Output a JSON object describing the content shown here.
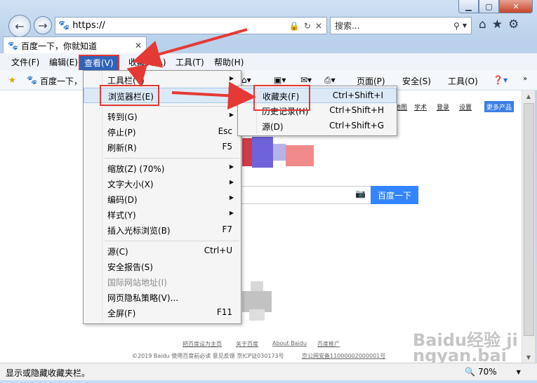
{
  "address": {
    "url": "https://"
  },
  "search": {
    "placeholder": "搜索..."
  },
  "tab": {
    "title": "百度一下，你就知道"
  },
  "menubar": {
    "file": "文件(F)",
    "edit": "编辑(E)",
    "view": "查看(V)",
    "favorites": "收藏夹(A)",
    "tools": "工具(T)",
    "help": "帮助(H)"
  },
  "cmdbar": {
    "favorite_item": "百度一下，...",
    "page": "页面(P)",
    "safety": "安全(S)",
    "tools": "工具(O)"
  },
  "view_menu": {
    "items": [
      {
        "label": "工具栏(T)",
        "shortcut": ""
      },
      {
        "label": "浏览器栏(E)",
        "shortcut": ""
      },
      {
        "label": "转到(G)",
        "shortcut": ""
      },
      {
        "label": "停止(P)",
        "shortcut": "Esc"
      },
      {
        "label": "刷新(R)",
        "shortcut": "F5"
      },
      {
        "label": "缩放(Z) (70%)",
        "shortcut": ""
      },
      {
        "label": "文字大小(X)",
        "shortcut": ""
      },
      {
        "label": "编码(D)",
        "shortcut": ""
      },
      {
        "label": "样式(Y)",
        "shortcut": ""
      },
      {
        "label": "插入光标浏览(B)",
        "shortcut": "F7"
      },
      {
        "label": "源(C)",
        "shortcut": "Ctrl+U"
      },
      {
        "label": "安全报告(S)",
        "shortcut": ""
      },
      {
        "label": "国际网站地址(I)",
        "shortcut": ""
      },
      {
        "label": "网页隐私策略(V)...",
        "shortcut": ""
      },
      {
        "label": "全屏(F)",
        "shortcut": "F11"
      }
    ]
  },
  "explorer_bar_menu": {
    "items": [
      {
        "label": "收藏夹(F)",
        "shortcut": "Ctrl+Shift+I"
      },
      {
        "label": "历史记录(H)",
        "shortcut": "Ctrl+Shift+H"
      },
      {
        "label": "源(D)",
        "shortcut": "Ctrl+Shift+G"
      }
    ]
  },
  "page": {
    "toplinks": [
      "地图",
      "学术",
      "登录",
      "设置"
    ],
    "more_products": "更多产品",
    "search_button": "百度一下",
    "footer_links": [
      "把百度设为主页",
      "关于百度",
      "About Baidu",
      "百度推广"
    ],
    "copyright": "©2019 Baidu 使用百度前必读 意见反馈 京ICP证030173号",
    "police": "京公网安备11000002000001号"
  },
  "status": {
    "text": "显示或隐藏收藏夹栏。",
    "zoom": "70%"
  },
  "watermark": "Baidu经验 jingyan.baidu.com",
  "colors": {
    "highlight_red": "#e53935",
    "menu_blue": "#2f63b8",
    "baidu_blue": "#3385ff"
  }
}
